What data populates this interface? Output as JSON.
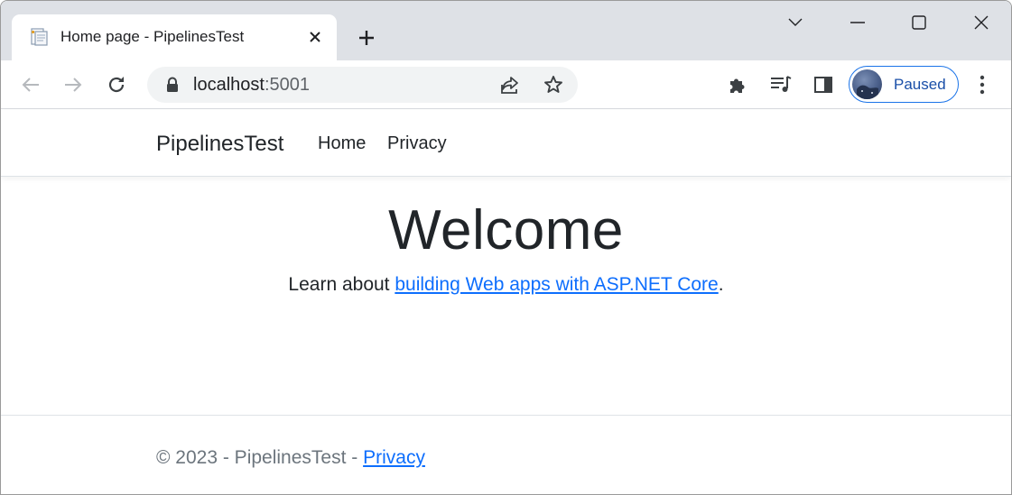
{
  "browser": {
    "tab": {
      "title": "Home page - PipelinesTest",
      "favicon": "document-icon",
      "close": "close-icon"
    },
    "new_tab": "plus-icon",
    "window_controls": [
      "chevron-down-icon",
      "minimize-icon",
      "maximize-icon",
      "close-icon"
    ],
    "toolbar": {
      "back": "arrow-left-icon",
      "forward": "arrow-right-icon",
      "reload": "reload-icon",
      "url_host": "localhost",
      "url_port": ":5001",
      "lock": "lock-icon",
      "share": "share-icon",
      "bookmark": "star-icon",
      "extensions": "puzzle-icon",
      "media": "playlist-icon",
      "side_panel": "side-panel-icon",
      "profile_label": "Paused",
      "menu": "kebab-menu-icon"
    },
    "colors": {
      "tabstrip": "#dee1e6",
      "accent": "#1a73e8",
      "link": "#0d6efd"
    }
  },
  "site": {
    "brand": "PipelinesTest",
    "nav": [
      "Home",
      "Privacy"
    ],
    "heading": "Welcome",
    "learn_prefix": "Learn about ",
    "learn_link": "building Web apps with ASP.NET Core",
    "learn_suffix": ".",
    "footer_text": "© 2023 - PipelinesTest - ",
    "footer_link": "Privacy"
  }
}
